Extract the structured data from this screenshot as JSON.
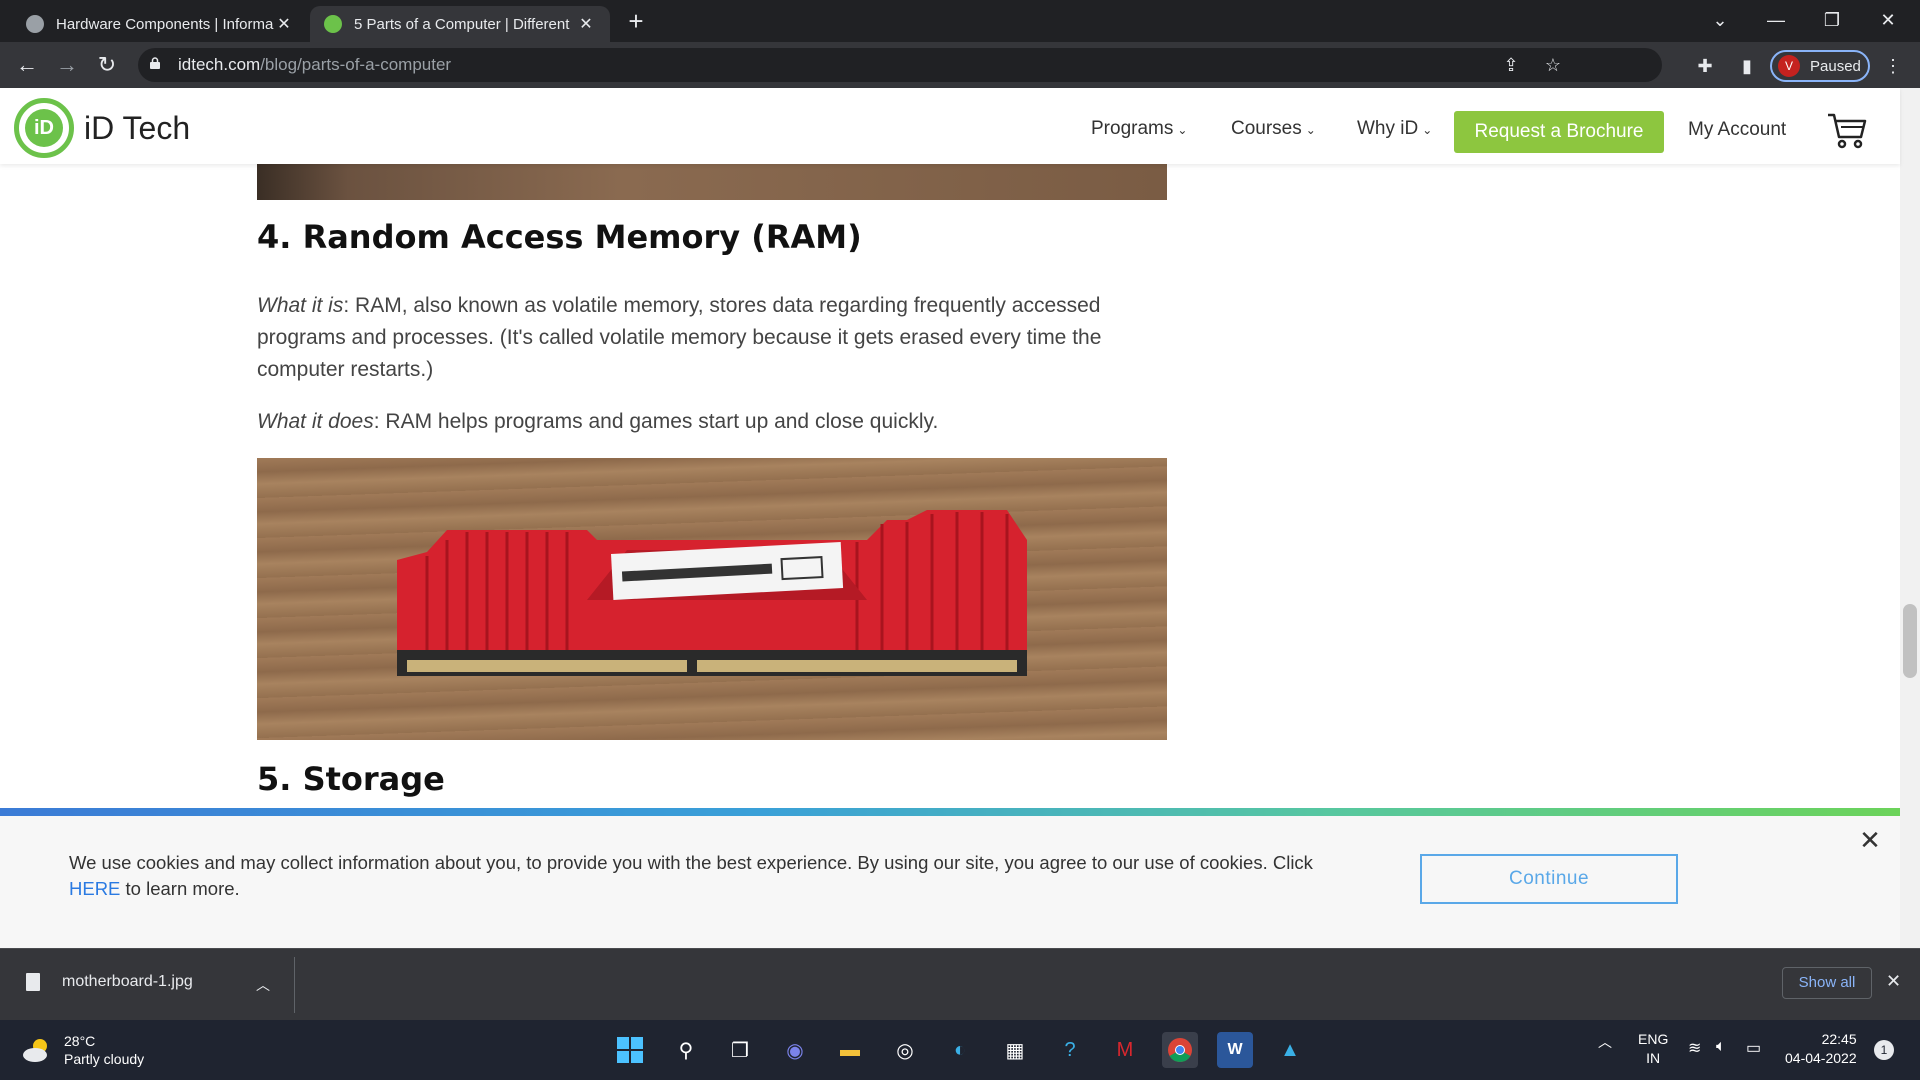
{
  "browser": {
    "tabs": [
      {
        "title": "Hardware Components | Informa",
        "active": false
      },
      {
        "title": "5 Parts of a Computer | Different",
        "active": true
      }
    ],
    "url_host": "idtech.com",
    "url_path": "/blog/parts-of-a-computer",
    "profile_initial": "V",
    "profile_status": "Paused"
  },
  "site": {
    "logo_text": "iD Tech",
    "logo_mark": "iD",
    "nav": {
      "programs": "Programs",
      "courses": "Courses",
      "why": "Why iD",
      "brochure": "Request a Brochure",
      "account": "My Account"
    },
    "brand_green": "#8dc63f"
  },
  "article": {
    "ram_heading": "4. Random Access Memory (RAM)",
    "what_it_is_label": "What it is",
    "what_it_is_text": ": RAM, also known as volatile memory, stores data regarding frequently accessed programs and processes. (It's called volatile memory because it gets erased every time the computer restarts.)",
    "what_it_does_label": "What it does",
    "what_it_does_text": ": RAM helps programs and games start up and close quickly.",
    "storage_heading": "5. Storage"
  },
  "cookie": {
    "text_before": "We use cookies and may collect information about you, to provide you with the best experience. By using our site, you agree to our use of cookies. Click ",
    "link": "HERE",
    "text_after": " to learn more.",
    "continue": "Continue"
  },
  "downloads": {
    "file": "motherboard-1.jpg",
    "show_all": "Show all"
  },
  "taskbar": {
    "temp": "28°C",
    "weather": "Partly cloudy",
    "lang_top": "ENG",
    "lang_bottom": "IN",
    "time": "22:45",
    "date": "04-04-2022",
    "notifications": "1"
  }
}
